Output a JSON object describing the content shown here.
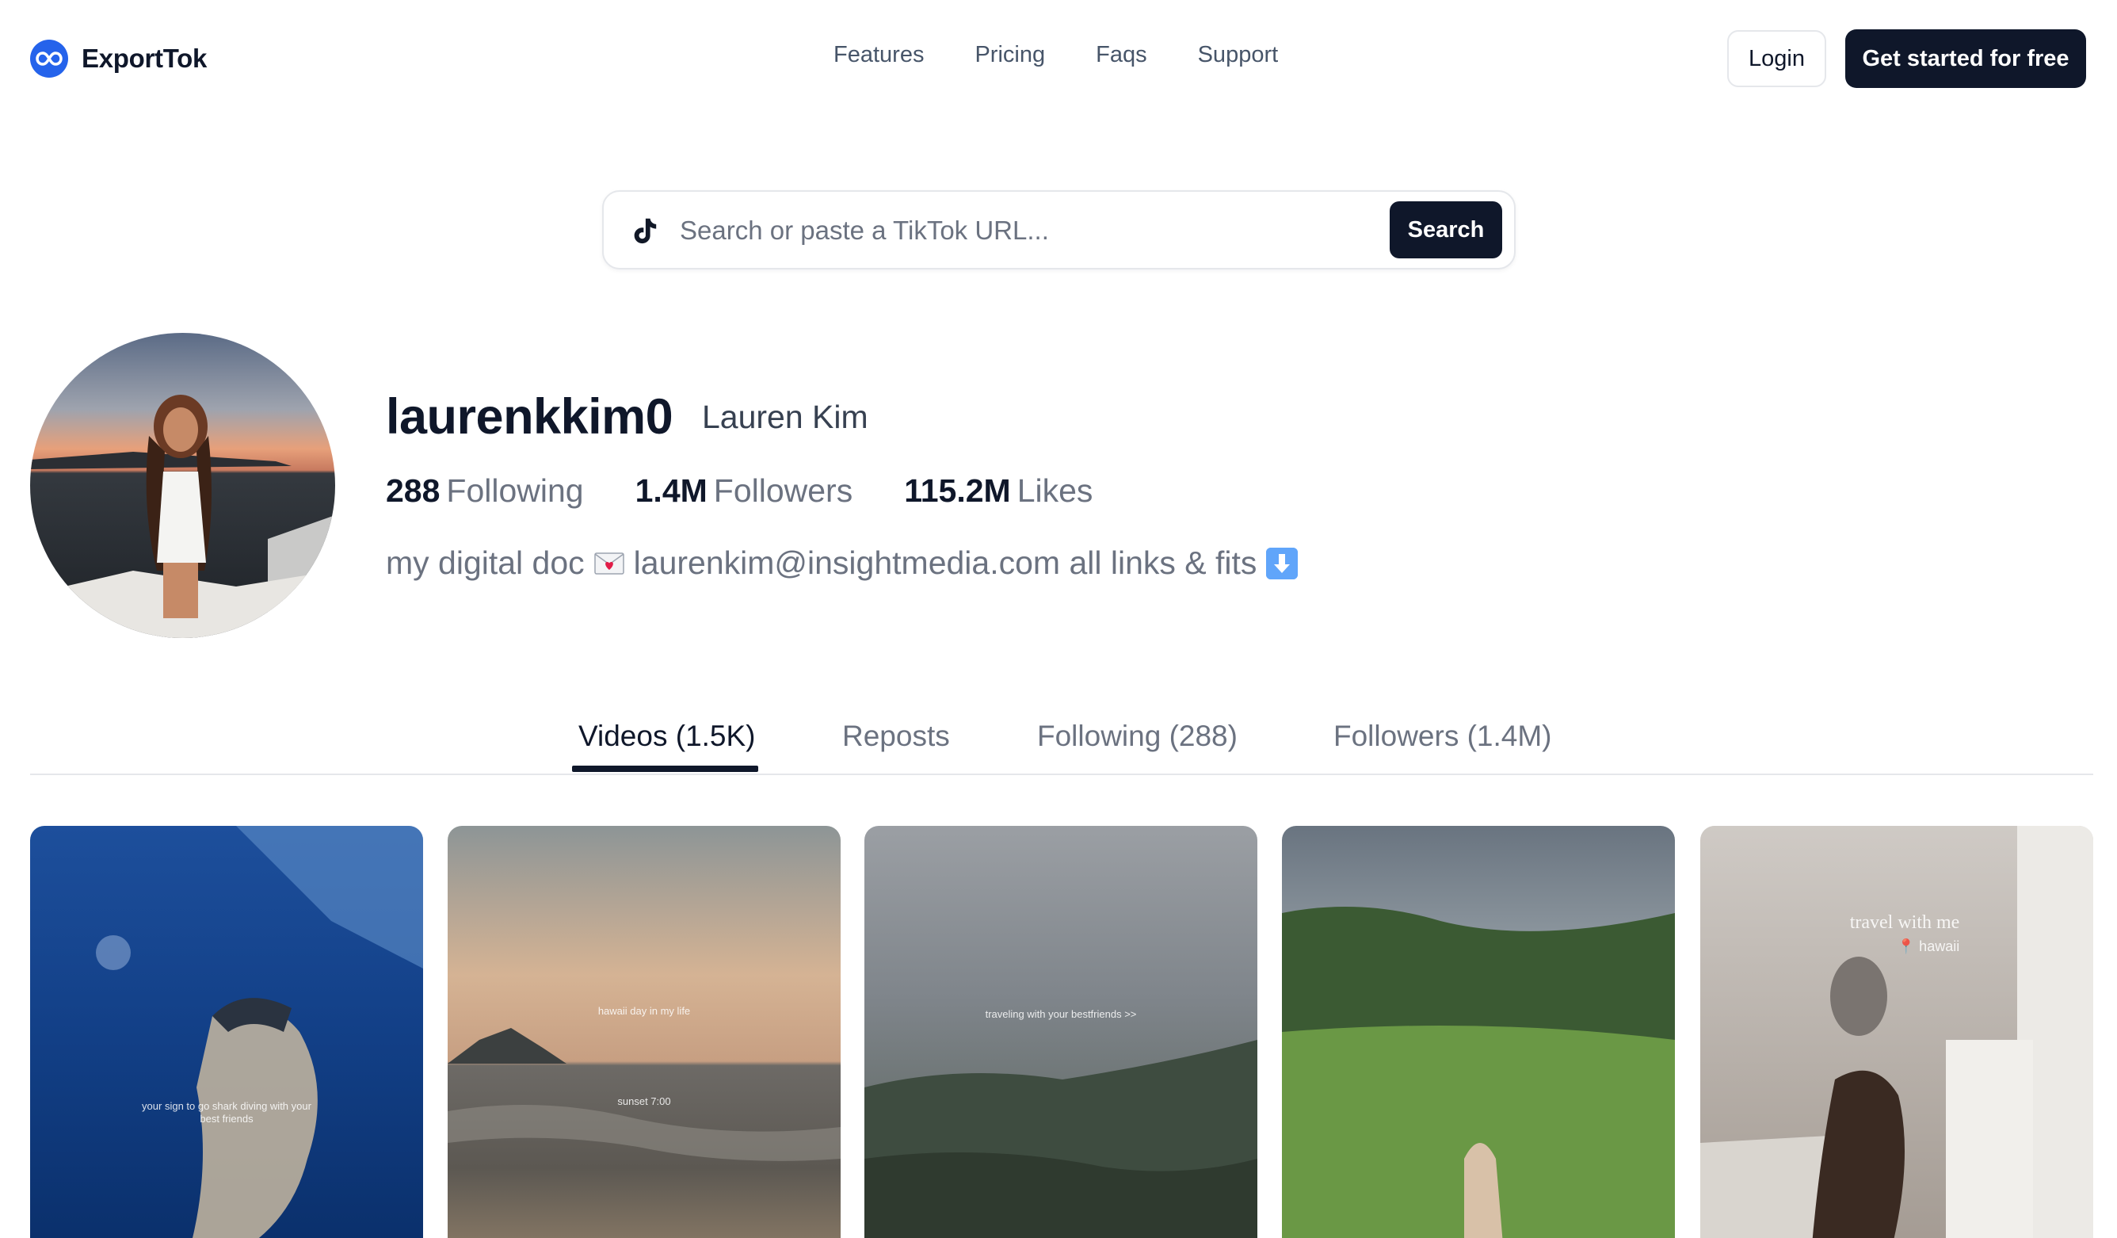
{
  "brand": {
    "name": "ExportTok",
    "logo_icon": "infinity-logo-icon",
    "logo_color": "#2563eb"
  },
  "nav": {
    "items": [
      "Features",
      "Pricing",
      "Faqs",
      "Support"
    ]
  },
  "auth": {
    "login_label": "Login",
    "cta_label": "Get started for free"
  },
  "search": {
    "placeholder": "Search or paste a TikTok URL...",
    "value": "",
    "button_label": "Search",
    "icon": "tiktok-icon"
  },
  "profile": {
    "username": "laurenkkim0",
    "display_name": "Lauren Kim",
    "stats": [
      {
        "value": "288",
        "label": "Following"
      },
      {
        "value": "1.4M",
        "label": "Followers"
      },
      {
        "value": "115.2M",
        "label": "Likes"
      }
    ],
    "bio_start": "my digital doc",
    "bio_email": "laurenkim@insightmedia.com all links & fits",
    "bio_icons": [
      "love-letter-icon",
      "down-arrow-icon"
    ]
  },
  "tabs": [
    {
      "label": "Videos (1.5K)",
      "active": true
    },
    {
      "label": "Reposts",
      "active": false
    },
    {
      "label": "Following (288)",
      "active": false
    },
    {
      "label": "Followers (1.4M)",
      "active": false
    }
  ],
  "videos": [
    {
      "caption": "your sign to go shark diving with your best friends",
      "scene": "underwater"
    },
    {
      "caption": "hawaii day in my life",
      "subcaption": "sunset 7:00",
      "scene": "beach-sunset"
    },
    {
      "caption": "traveling with your bestfriends >>",
      "scene": "mountain-clouds"
    },
    {
      "caption": "",
      "scene": "mountain-yoga"
    },
    {
      "caption": "travel with me",
      "subcaption": "📍 hawaii",
      "scene": "bedroom"
    }
  ],
  "colors": {
    "primary_dark": "#0f172a",
    "muted_text": "#6b7280",
    "border": "#e5e7eb"
  }
}
